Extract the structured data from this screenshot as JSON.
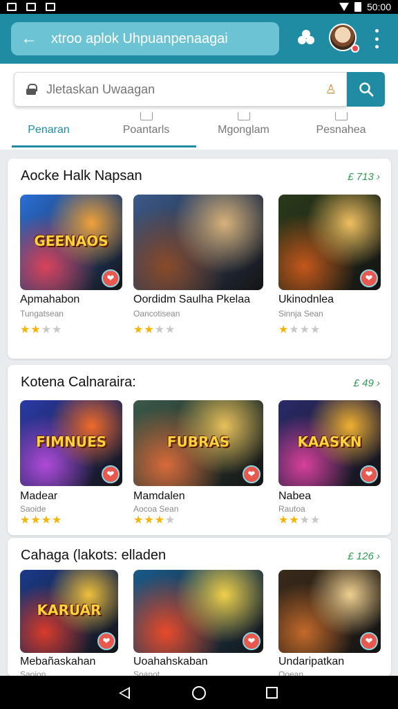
{
  "status_bar": {
    "time": "50:00"
  },
  "app_bar": {
    "title": "xtroo aplok Uhpuanpenaagai"
  },
  "search": {
    "placeholder": "Jletaskan Uwaagan"
  },
  "tabs": [
    {
      "label": "Penaran",
      "active": true
    },
    {
      "label": "Poantarls",
      "active": false
    },
    {
      "label": "Mgonglam",
      "active": false
    },
    {
      "label": "Pesnahea",
      "active": false
    }
  ],
  "sections": [
    {
      "title": "Aocke Halk Napsan",
      "more": "£ 713",
      "cards": [
        {
          "title": "Apmahabon",
          "subtitle": "Tungatsean",
          "rating": 2,
          "art": "GEENAOS",
          "colors": [
            "#2a6fd6",
            "#d9425a",
            "#f0a23a"
          ]
        },
        {
          "title": "Oordidm Saulha Pkelaa",
          "subtitle": "Oancotisean",
          "rating": 2,
          "art": "",
          "colors": [
            "#3c5a8a",
            "#8a4a2a",
            "#d8b27a"
          ]
        },
        {
          "title": "Ukinodnlea",
          "subtitle": "Sinnja Sean",
          "rating": 1,
          "art": "",
          "colors": [
            "#2a3a1a",
            "#c4571a",
            "#f0c060"
          ]
        }
      ]
    },
    {
      "title": "Kotena Calnaraira:",
      "more": "£ 49",
      "cards": [
        {
          "title": "Madear",
          "subtitle": "Saoide",
          "rating": 4,
          "art": "FIMNUES",
          "colors": [
            "#2a3aa8",
            "#b04ad8",
            "#f06a2a"
          ]
        },
        {
          "title": "Mamdalen",
          "subtitle": "Aocoa Sean",
          "rating": 3,
          "art": "FUBRAS",
          "colors": [
            "#3a5a4a",
            "#d86a3a",
            "#e8c05a"
          ]
        },
        {
          "title": "Nabea",
          "subtitle": "Rautoa",
          "rating": 2,
          "art": "KAASKN",
          "colors": [
            "#2a2a6a",
            "#d8409a",
            "#f0b030"
          ]
        }
      ]
    },
    {
      "title": "Cahaga (lakots: elladen",
      "more": "£ 126",
      "cards": [
        {
          "title": "Mebañaskahan",
          "subtitle": "Saoion",
          "rating": 0,
          "art": "KARUAR",
          "colors": [
            "#1a3a8a",
            "#d83a2a",
            "#f0c03a"
          ]
        },
        {
          "title": "Uoahahskaban",
          "subtitle": "Soanot",
          "rating": 0,
          "art": "",
          "colors": [
            "#1a5a8a",
            "#e84a2a",
            "#f0d04a"
          ]
        },
        {
          "title": "Undaripatkan",
          "subtitle": "Ooean",
          "rating": 0,
          "art": "",
          "colors": [
            "#3a2a1a",
            "#c46a2a",
            "#f0d090"
          ]
        }
      ]
    }
  ]
}
